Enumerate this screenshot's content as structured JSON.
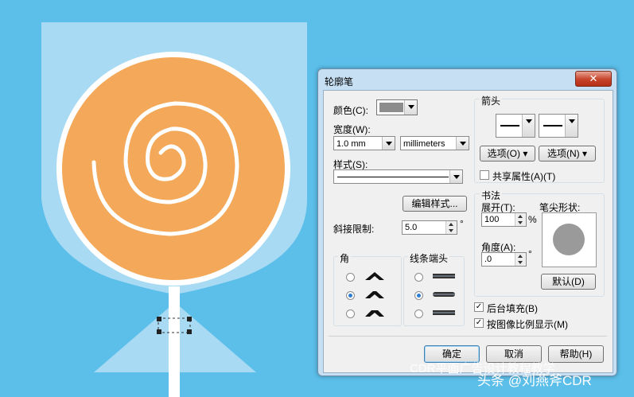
{
  "dialog": {
    "title": "轮廓笔",
    "close_glyph": "✕",
    "color_label": "颜色(C):",
    "width_label": "宽度(W):",
    "width_value": "1.0 mm",
    "units_value": "millimeters",
    "style_label": "样式(S):",
    "edit_style_button": "编辑样式...",
    "miter_label": "斜接限制:",
    "miter_value": "5.0",
    "miter_unit": "°",
    "corners_label": "角",
    "line_caps_label": "线条端头",
    "arrows_label": "箭头",
    "options_left": "选项(O)",
    "options_right": "选项(N)",
    "share_attributes": "共享属性(A)(T)",
    "calligraphy_label": "书法",
    "stretch_label": "展开(T):",
    "stretch_value": "100",
    "stretch_unit": "%",
    "angle_label": "角度(A):",
    "angle_value": ".0",
    "angle_unit": "°",
    "nib_shape_label": "笔尖形状:",
    "default_button": "默认(D)",
    "behind_fill": "后台填充(B)",
    "scale_with_image": "按图像比例显示(M)",
    "ok_button": "确定",
    "cancel_button": "取消",
    "help_button": "帮助(H)",
    "behind_fill_checked": true,
    "scale_with_image_checked": true,
    "share_attributes_checked": false,
    "corner_selected": 2,
    "cap_selected": 2
  },
  "watermark": {
    "line1": "CDR平面广告设计教程教学",
    "line2": "头条 @刘燕斧CDR"
  },
  "colors": {
    "background": "#5bbfea",
    "candy": "#f4a95a",
    "cup": "#a8daf3",
    "close_red": "#c7432b"
  }
}
